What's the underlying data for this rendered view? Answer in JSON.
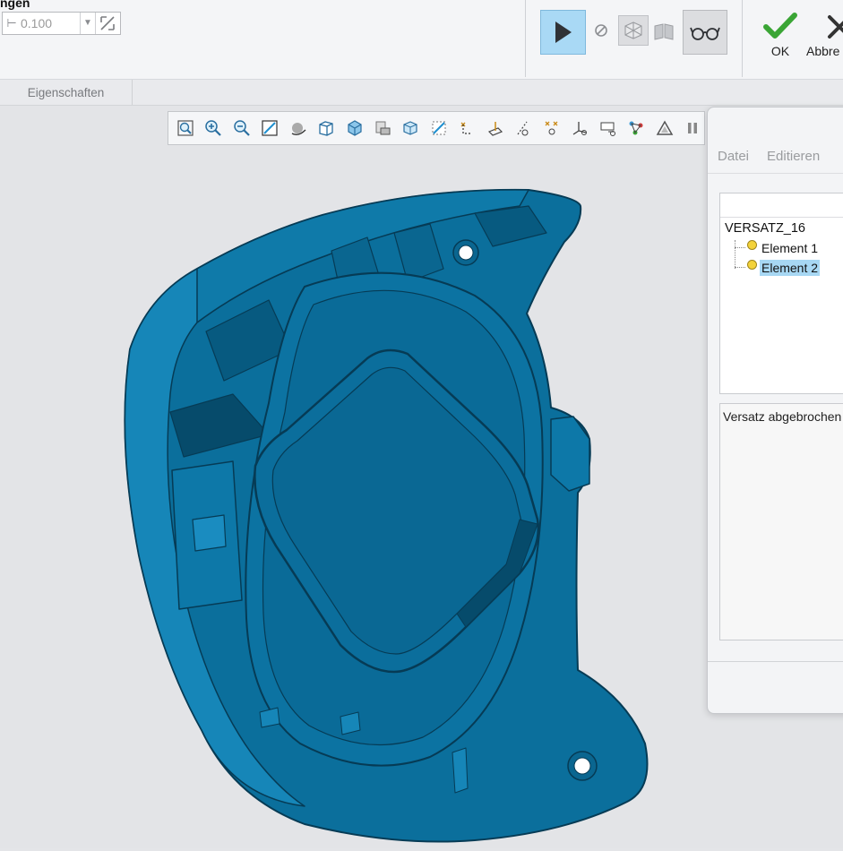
{
  "ribbon": {
    "section_label": "ngen",
    "thickness_value": "0.100",
    "ok_label": "OK",
    "cancel_label": "Abbre"
  },
  "tabs": [
    {
      "label": "Eigenschaften"
    }
  ],
  "view_toolbar": {
    "icons": [
      "zoom-fit-icon",
      "zoom-in-icon",
      "zoom-out-icon",
      "repaint-icon",
      "spin-center-icon",
      "display-style-icon",
      "saved-views-icon",
      "view-manager-icon",
      "perspective-icon",
      "section-icon",
      "datum-planes-icon",
      "datum-axes-icon",
      "datum-points-icon",
      "point-tags-icon",
      "csys-icon",
      "annotation-display-icon",
      "spin-icon",
      "measure-icon",
      "pause-icon"
    ]
  },
  "model": {
    "color": "#0b6f9c",
    "edge_color": "#063b55"
  },
  "dialog": {
    "menu": [
      "Datei",
      "Editieren"
    ],
    "tree": {
      "root": "VERSATZ_16",
      "items": [
        {
          "label": "Element 1",
          "selected": false
        },
        {
          "label": "Element 2",
          "selected": true
        }
      ]
    },
    "message": "Versatz abgebrochen"
  }
}
